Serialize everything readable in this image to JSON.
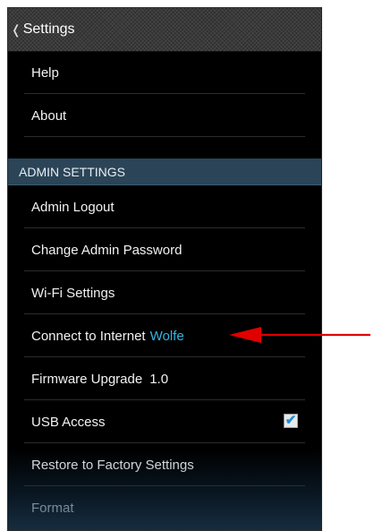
{
  "topbar": {
    "chevron": "❬",
    "title": "Settings"
  },
  "general": [
    {
      "label": "Help"
    },
    {
      "label": "About"
    }
  ],
  "admin": {
    "header": "ADMIN SETTINGS",
    "logout": "Admin Logout",
    "change_password": "Change Admin Password",
    "wifi_settings": "Wi-Fi Settings",
    "connect_internet": {
      "label": "Connect to Internet",
      "network": "Wolfe"
    },
    "firmware": {
      "label": "Firmware Upgrade",
      "version": "1.0"
    },
    "usb": {
      "label": "USB Access",
      "checked": true,
      "check_glyph": "✔"
    },
    "restore": "Restore to Factory Settings",
    "format": "Format"
  },
  "colors": {
    "accent": "#33b5e5",
    "section_header": "#2b4457",
    "arrow": "#e00000"
  },
  "icons": {
    "back": "chevron-left-icon",
    "check": "checkmark-icon",
    "annotation": "red-arrow-icon"
  }
}
